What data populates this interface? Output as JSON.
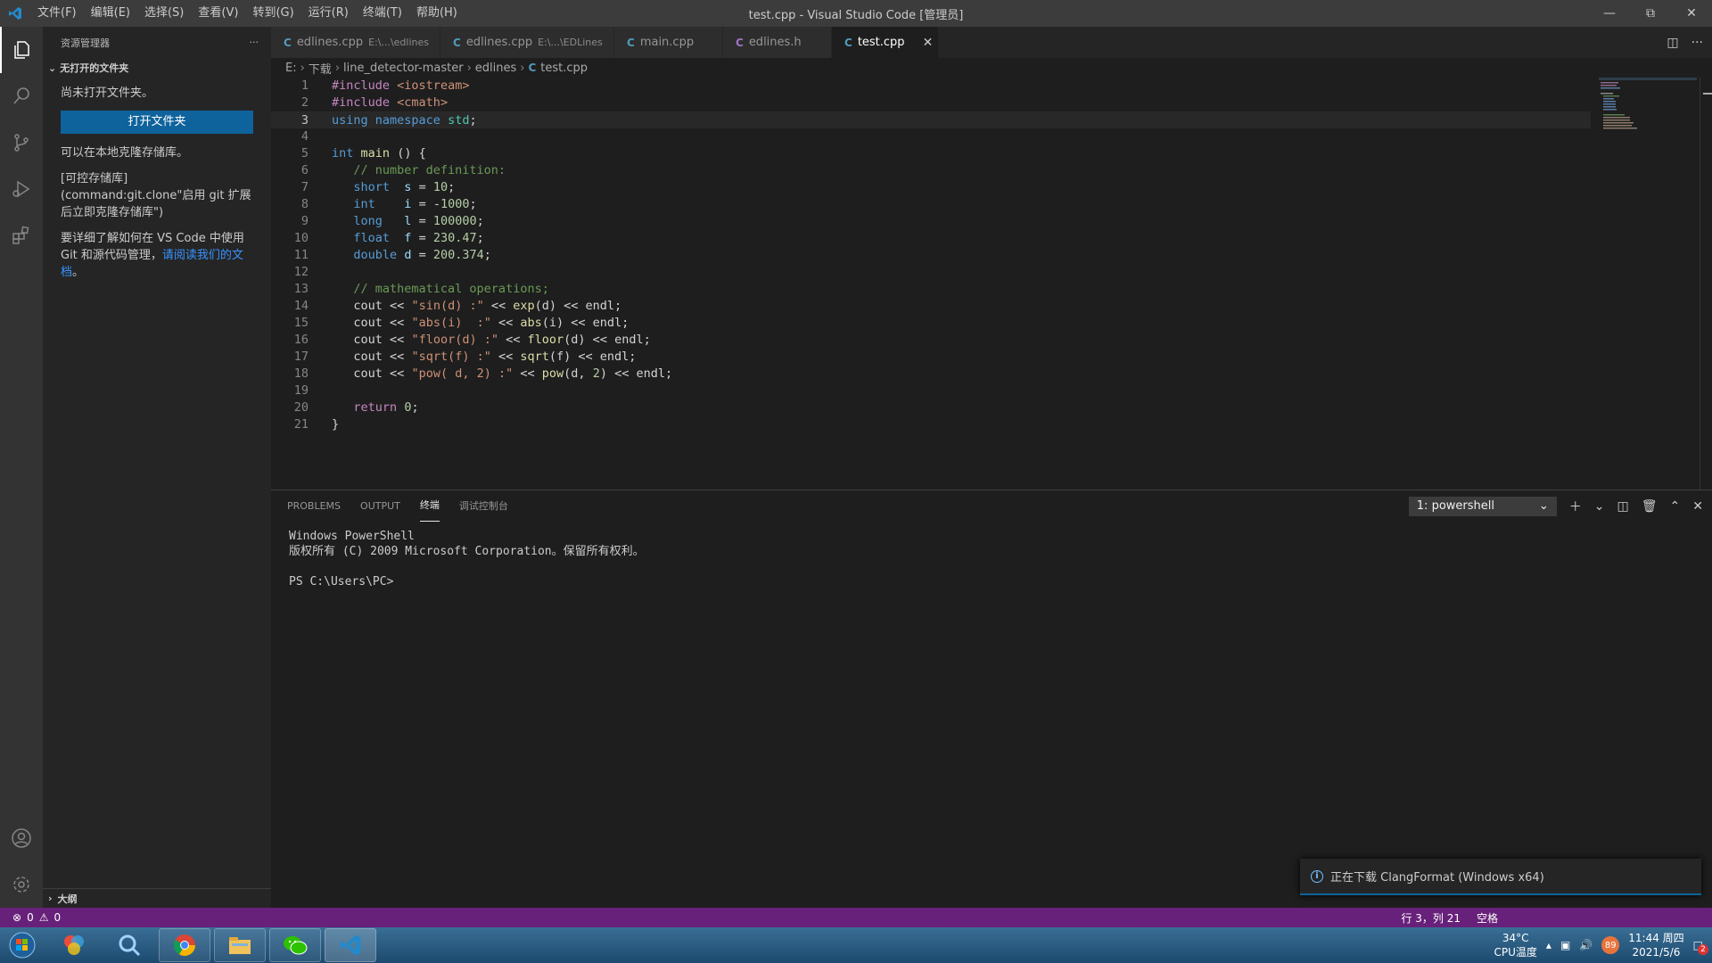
{
  "window": {
    "title": "test.cpp - Visual Studio Code [管理员]",
    "menu": [
      "文件(F)",
      "编辑(E)",
      "选择(S)",
      "查看(V)",
      "转到(G)",
      "运行(R)",
      "终端(T)",
      "帮助(H)"
    ]
  },
  "sidebar": {
    "header": "资源管理器",
    "section": "无打开的文件夹",
    "no_folder": "尚未打开文件夹。",
    "open_button": "打开文件夹",
    "clone_hint": "可以在本地克隆存储库。",
    "clone_command": "[可控存储库](command:git.clone\"启用 git 扩展后立即克隆存储库\")",
    "docs_text": "要详细了解如何在 VS Code 中使用 Git 和源代码管理，",
    "docs_link": "请阅读我们的文档",
    "docs_end": "。",
    "outline": "大纲"
  },
  "tabs": [
    {
      "icon": "C",
      "name": "edlines.cpp",
      "desc": "E:\\...\\edlines"
    },
    {
      "icon": "C",
      "name": "edlines.cpp",
      "desc": "E:\\...\\EDLines"
    },
    {
      "icon": "C",
      "name": "main.cpp",
      "desc": ""
    },
    {
      "icon": "C",
      "name": "edlines.h",
      "desc": ""
    },
    {
      "icon": "C",
      "name": "test.cpp",
      "desc": ""
    }
  ],
  "breadcrumb": [
    "E:",
    "下载",
    "line_detector-master",
    "edlines",
    "test.cpp"
  ],
  "editor": {
    "line_numbers": [
      "1",
      "2",
      "3",
      "4",
      "5",
      "6",
      "7",
      "8",
      "9",
      "10",
      "11",
      "12",
      "13",
      "14",
      "15",
      "16",
      "17",
      "18",
      "19",
      "20",
      "21"
    ],
    "current_line": 3
  },
  "panel": {
    "tabs": [
      "PROBLEMS",
      "OUTPUT",
      "终端",
      "调试控制台"
    ],
    "active_tab": "终端",
    "terminal_select": "1: powershell",
    "terminal_lines": [
      "Windows PowerShell",
      "版权所有 (C) 2009 Microsoft Corporation。保留所有权利。",
      "",
      "PS C:\\Users\\PC>"
    ]
  },
  "notification": "正在下载 ClangFormat (Windows x64)",
  "statusbar": {
    "errors": "0",
    "warnings": "0",
    "position": "行 3，列 21",
    "spaces": "空格"
  },
  "taskbar": {
    "temp": "34°C",
    "temp_label": "CPU温度",
    "time": "11:44 周四",
    "date": "2021/5/6",
    "badge": "89",
    "notif_count": "2"
  },
  "colors": {
    "accent": "#0e639c",
    "statusbar": "#68217a",
    "editor_bg": "#1e1e1e"
  }
}
